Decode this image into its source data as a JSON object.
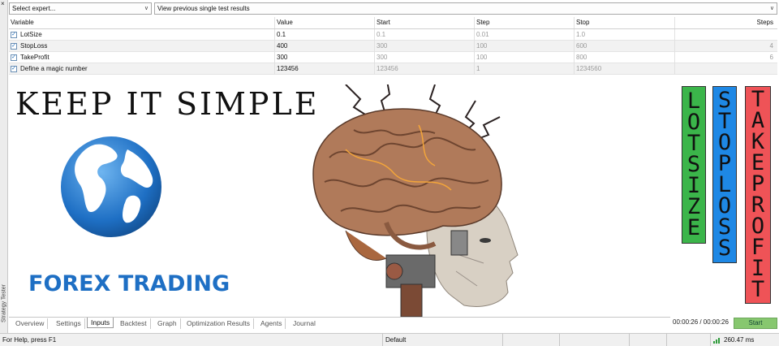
{
  "window": {
    "close_glyph": "×",
    "panel_title": "Strategy Tester"
  },
  "toolbar": {
    "expert_select": "Select expert...",
    "results_select": "View previous single test results"
  },
  "params": {
    "headers": {
      "variable": "Variable",
      "value": "Value",
      "start": "Start",
      "step": "Step",
      "stop": "Stop",
      "steps": "Steps"
    },
    "rows": [
      {
        "name": "LotSize",
        "value": "0.1",
        "start": "0.1",
        "step": "0.01",
        "stop": "1.0",
        "steps": ""
      },
      {
        "name": "StopLoss",
        "value": "400",
        "start": "300",
        "step": "100",
        "stop": "600",
        "steps": "4"
      },
      {
        "name": "TakeProfit",
        "value": "300",
        "start": "300",
        "step": "100",
        "stop": "800",
        "steps": "6"
      },
      {
        "name": "Define a magic number",
        "value": "123456",
        "start": "123456",
        "step": "1",
        "stop": "1234560",
        "steps": ""
      }
    ]
  },
  "banner": {
    "headline": "KEEP IT SIMPLE",
    "brand": "FOREX TRADING",
    "vertical_labels": [
      "LOTSIZE",
      "STOPLOSS",
      "TAKEPROFIT"
    ],
    "colors": {
      "lotsize": "#3bb54a",
      "stoploss": "#1e88e5",
      "takeprofit": "#ef5357",
      "globe": "#1e6fc4"
    }
  },
  "tabs": [
    "Overview",
    "Settings",
    "Inputs",
    "Backtest",
    "Graph",
    "Optimization Results",
    "Agents",
    "Journal"
  ],
  "active_tab": "Inputs",
  "timer": "00:00:26 / 00:00:26",
  "start_button": "Start",
  "status": {
    "help": "For Help, press F1",
    "profile": "Default",
    "ping": "260.47 ms"
  }
}
